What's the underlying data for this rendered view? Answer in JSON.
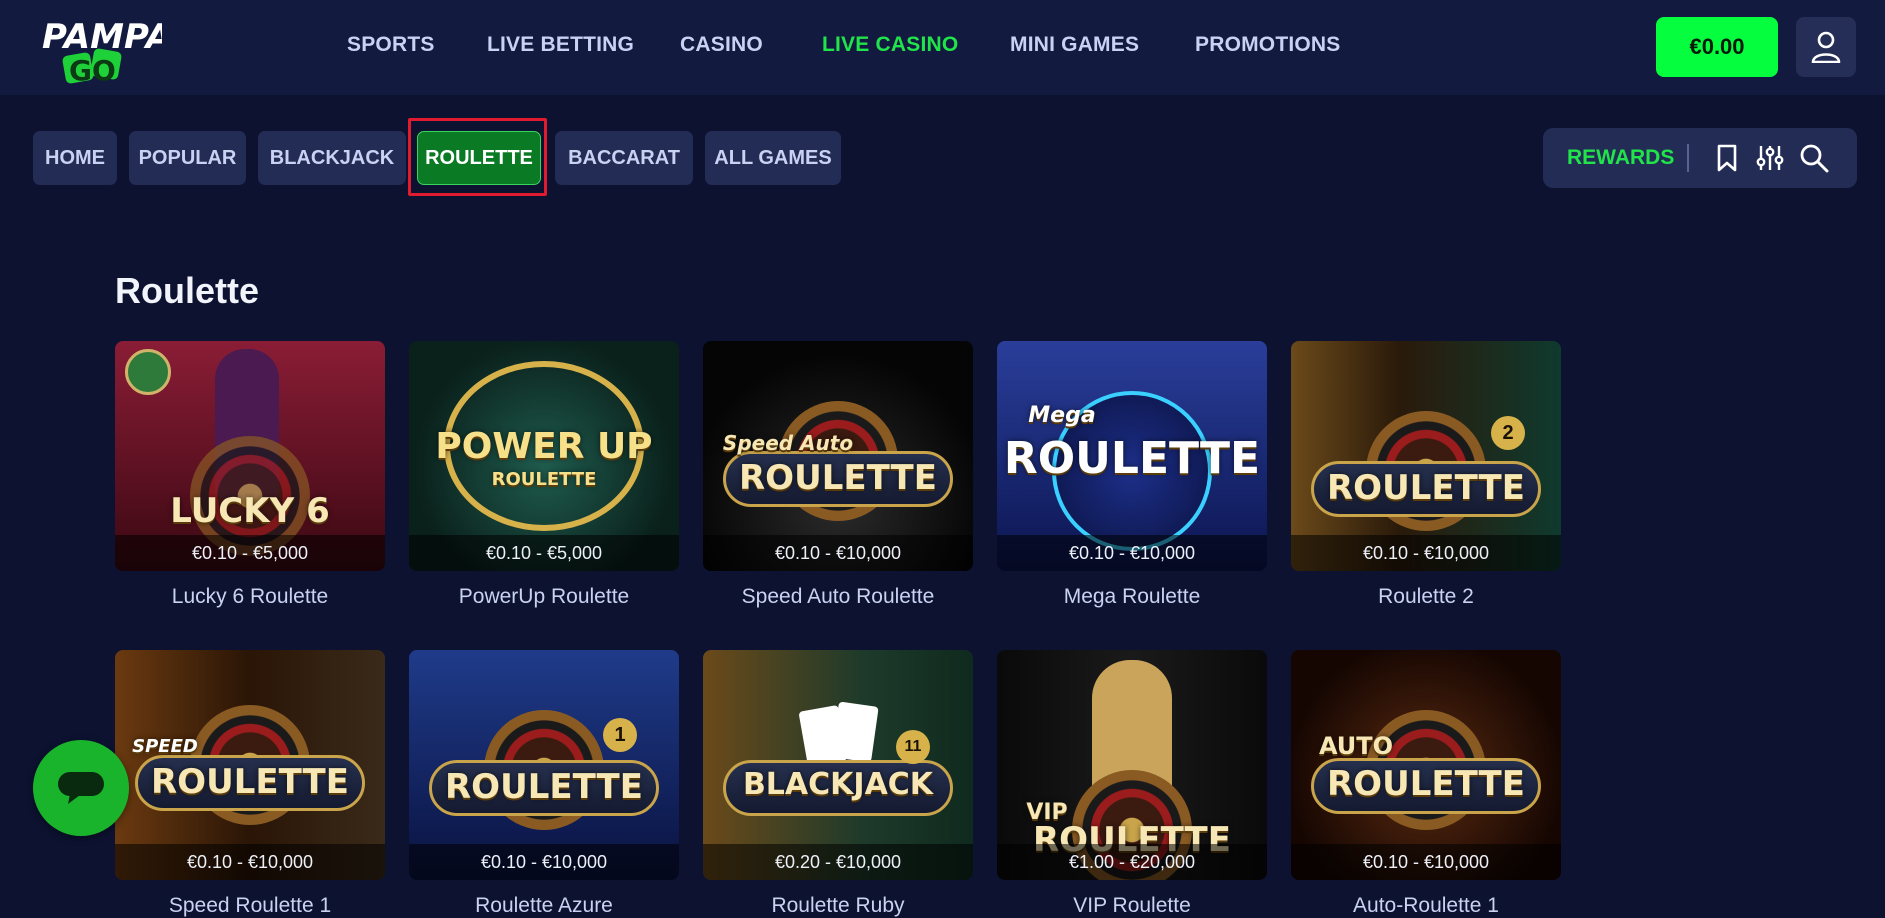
{
  "brand": {
    "logo_top": "PAMPA",
    "logo_bottom": "GO"
  },
  "nav": [
    {
      "label": "SPORTS"
    },
    {
      "label": "LIVE BETTING"
    },
    {
      "label": "CASINO"
    },
    {
      "label": "LIVE CASINO",
      "active": true
    },
    {
      "label": "MINI GAMES"
    },
    {
      "label": "PROMOTIONS"
    }
  ],
  "header": {
    "balance": "€0.00",
    "user_icon": "user-icon"
  },
  "categories": [
    {
      "label": "HOME"
    },
    {
      "label": "POPULAR"
    },
    {
      "label": "BLACKJACK"
    },
    {
      "label": "ROULETTE",
      "active": true
    },
    {
      "label": "BACCARAT"
    },
    {
      "label": "ALL GAMES"
    }
  ],
  "tools": {
    "rewards": "REWARDS",
    "icons": [
      "bookmark-icon",
      "filter-sliders-icon",
      "search-icon"
    ]
  },
  "section": {
    "title": "Roulette"
  },
  "games": [
    {
      "title": "Lucky 6 Roulette",
      "stakes": "€0.10 - €5,000",
      "art": "LUCKY 6",
      "bg": "#7a1530"
    },
    {
      "title": "PowerUp Roulette",
      "stakes": "€0.10 - €5,000",
      "art": "POWER UP",
      "art2": "ROULETTE",
      "bg": "#0f3b33"
    },
    {
      "title": "Speed Auto Roulette",
      "stakes": "€0.10 - €10,000",
      "art": "ROULETTE",
      "art_small": "Speed Auto",
      "bg": "#121212"
    },
    {
      "title": "Mega Roulette",
      "stakes": "€0.10 - €10,000",
      "art": "ROULETTE",
      "art_small": "Mega",
      "bg": "#1a2f7a"
    },
    {
      "title": "Roulette 2",
      "stakes": "€0.10 - €10,000",
      "art": "ROULETTE",
      "badge": "2",
      "bg": "#4a3314"
    },
    {
      "title": "Speed Roulette 1",
      "stakes": "€0.10 - €10,000",
      "art": "ROULETTE",
      "art_small": "SPEED",
      "bg": "#5a3510"
    },
    {
      "title": "Roulette Azure",
      "stakes": "€0.10 - €10,000",
      "art": "ROULETTE",
      "badge": "1",
      "bg": "#15307a"
    },
    {
      "title": "Roulette Ruby",
      "stakes": "€0.20 - €10,000",
      "art": "BLACKJACK",
      "badge": "11",
      "bg": "#1d3a2a"
    },
    {
      "title": "VIP Roulette",
      "stakes": "€1.00 - €20,000",
      "art": "ROULETTE",
      "art_small": "VIP",
      "bg": "#141414"
    },
    {
      "title": "Auto-Roulette 1",
      "stakes": "€0.10 - €10,000",
      "art": "ROULETTE",
      "art_small": "AUTO",
      "bg": "#2a1208"
    }
  ],
  "chat": {
    "icon": "chat-bubble-icon"
  },
  "colors": {
    "accent_green": "#21e34a",
    "balance_green": "#05ff3f",
    "highlight_red": "#e01b2f"
  }
}
